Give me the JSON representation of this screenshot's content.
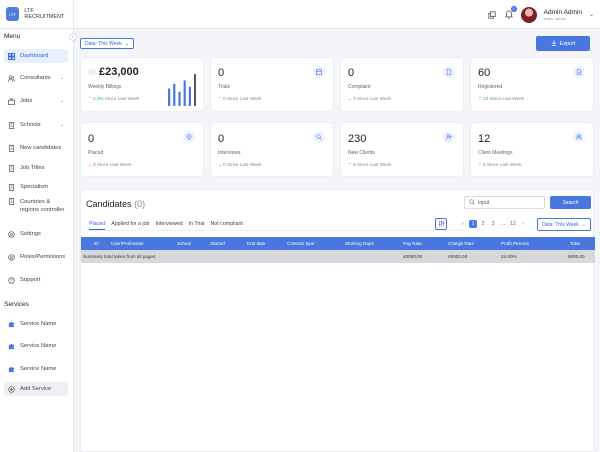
{
  "header": {
    "logo_mark": "LTF",
    "app_name": "LTF RECRUITMENT",
    "notification_count": "2",
    "user_name": "Admin Admin",
    "user_role": "super admin"
  },
  "sidebar": {
    "menu_title": "Menu",
    "items": [
      {
        "label": "Dashboard",
        "icon": "dashboard-icon"
      },
      {
        "label": "Consultants",
        "icon": "users-icon"
      },
      {
        "label": "Jobs",
        "icon": "briefcase-icon"
      },
      {
        "label": "Schools",
        "icon": "building-icon"
      },
      {
        "label": "New candidates",
        "icon": "building-icon"
      },
      {
        "label": "Job Titles",
        "icon": "building-icon"
      },
      {
        "label": "Specialism",
        "icon": "building-icon"
      },
      {
        "label": "Countries & regions controller",
        "icon": "building-icon"
      },
      {
        "label": "Settings",
        "icon": "gear-icon"
      },
      {
        "label": "Roles/Permisions",
        "icon": "shield-icon"
      },
      {
        "label": "Support",
        "icon": "help-icon"
      }
    ],
    "services_title": "Services",
    "services": [
      "Service Name",
      "Service Name",
      "Service Name"
    ],
    "add_service": "Add Service"
  },
  "toolbar": {
    "date_filter": "Data: This Week",
    "export_label": "Export"
  },
  "stats": [
    {
      "value": "£23,000",
      "label": "Weekly Billings",
      "change": "2.3%",
      "since": "Since Last Week",
      "trend": "up"
    },
    {
      "value": "0",
      "label": "Trials",
      "change": "0",
      "since": "Since Last Week",
      "trend": "up"
    },
    {
      "value": "0",
      "label": "Complaint",
      "change": "0",
      "since": "Since Last Week",
      "trend": "down"
    },
    {
      "value": "60",
      "label": "Registered",
      "change": "12",
      "since": "Since Last Week",
      "trend": "up"
    },
    {
      "value": "0",
      "label": "Placed",
      "change": "0",
      "since": "Since Last Week",
      "trend": "down"
    },
    {
      "value": "0",
      "label": "Interviews",
      "change": "0",
      "since": "Since Last Week",
      "trend": "down"
    },
    {
      "value": "230",
      "label": "New Clients",
      "change": "6",
      "since": "Since Last Week",
      "trend": "up"
    },
    {
      "value": "12",
      "label": "Client Meetings",
      "change": "5",
      "since": "Since Last Week",
      "trend": "up"
    }
  ],
  "billing_bars": [
    0.55,
    0.7,
    0.45,
    0.8,
    0.6,
    1.0
  ],
  "candidates": {
    "title": "Candidates",
    "count": "(0)",
    "search_placeholder": "Input",
    "search_button": "Search",
    "tabs": [
      "Placed",
      "Applied for a job",
      "Interviewed",
      "In Trial",
      "Not compliant"
    ],
    "pages": [
      "1",
      "2",
      "3",
      "...",
      "12"
    ],
    "date_filter": "Data: This Week",
    "columns": [
      "ID",
      "User/Profession",
      "School",
      "Started",
      "End date",
      "Contract type",
      "Working Days",
      "Pay Rate",
      "Charge Rate",
      "Profit Percent",
      "Total"
    ],
    "summary": {
      "label": "Summary total taken from all pages:",
      "pay_rate": "40000.00",
      "charge_rate": "45000.00",
      "profit_percent": "24.00%",
      "total": "5000.00"
    }
  },
  "colors": {
    "accent": "#4a76e0",
    "up": "#27ae60",
    "down": "#e74c3c"
  }
}
